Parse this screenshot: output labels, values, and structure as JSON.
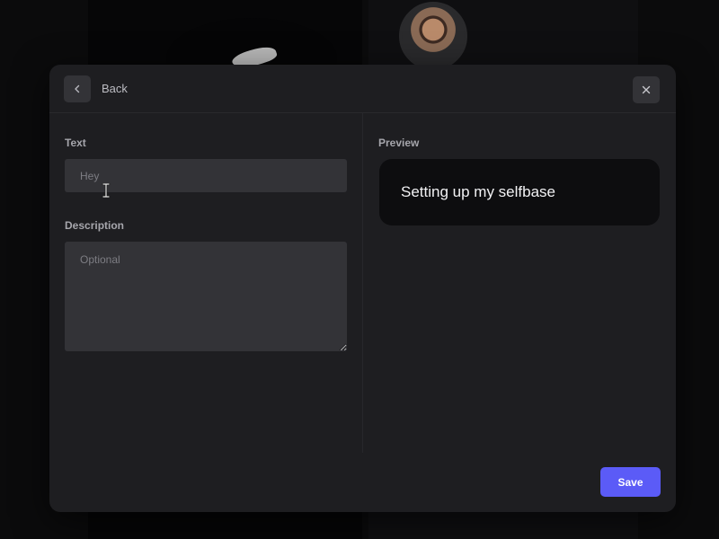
{
  "header": {
    "back_label": "Back",
    "back_icon": "chevron-left-icon",
    "close_icon": "close-icon"
  },
  "form": {
    "text_label": "Text",
    "text_placeholder": "Hey",
    "description_label": "Description",
    "description_placeholder": "Optional"
  },
  "preview": {
    "label": "Preview",
    "text": "Setting up my selfbase"
  },
  "footer": {
    "save_label": "Save"
  },
  "colors": {
    "accent": "#5b5bf7",
    "modal_bg": "#1e1e21",
    "input_bg": "#333337",
    "preview_bg": "#0d0d0f"
  }
}
